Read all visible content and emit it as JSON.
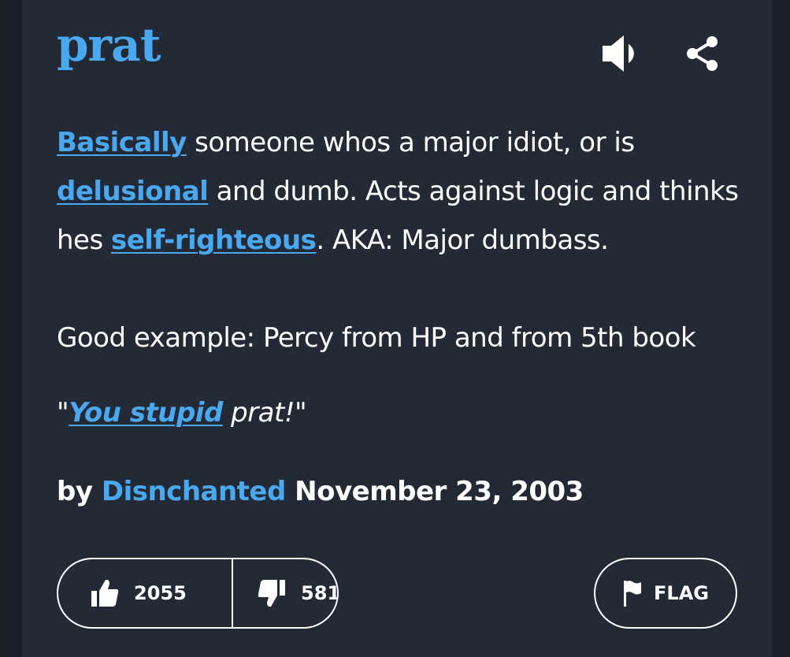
{
  "entry": {
    "word": "prat",
    "meaning": {
      "line1_link": "Basically",
      "line1_text": " someone whos a major idiot, or is ",
      "line2_link": "delusional",
      "line2_text": " and dumb. Acts against logic and thinks hes ",
      "line3_link": "self-righteous",
      "line3_text": ". AKA: Major dumbass.",
      "paragraph2": "Good example: Percy from HP and from 5th book"
    },
    "example": {
      "open_quote": "\"",
      "link": "You stupid",
      "rest": " prat!\""
    },
    "contributor": {
      "by": "by ",
      "author": "Disnchanted",
      "date": " November 23, 2003"
    },
    "votes": {
      "up": "2055",
      "down": "581"
    },
    "flag_label": "FLAG"
  },
  "colors": {
    "background": "#232a36",
    "accent": "#4aa8f0",
    "text": "#ffffff"
  },
  "icons": [
    "speaker-icon",
    "share-icon",
    "thumbs-up-icon",
    "thumbs-down-icon",
    "flag-icon"
  ]
}
